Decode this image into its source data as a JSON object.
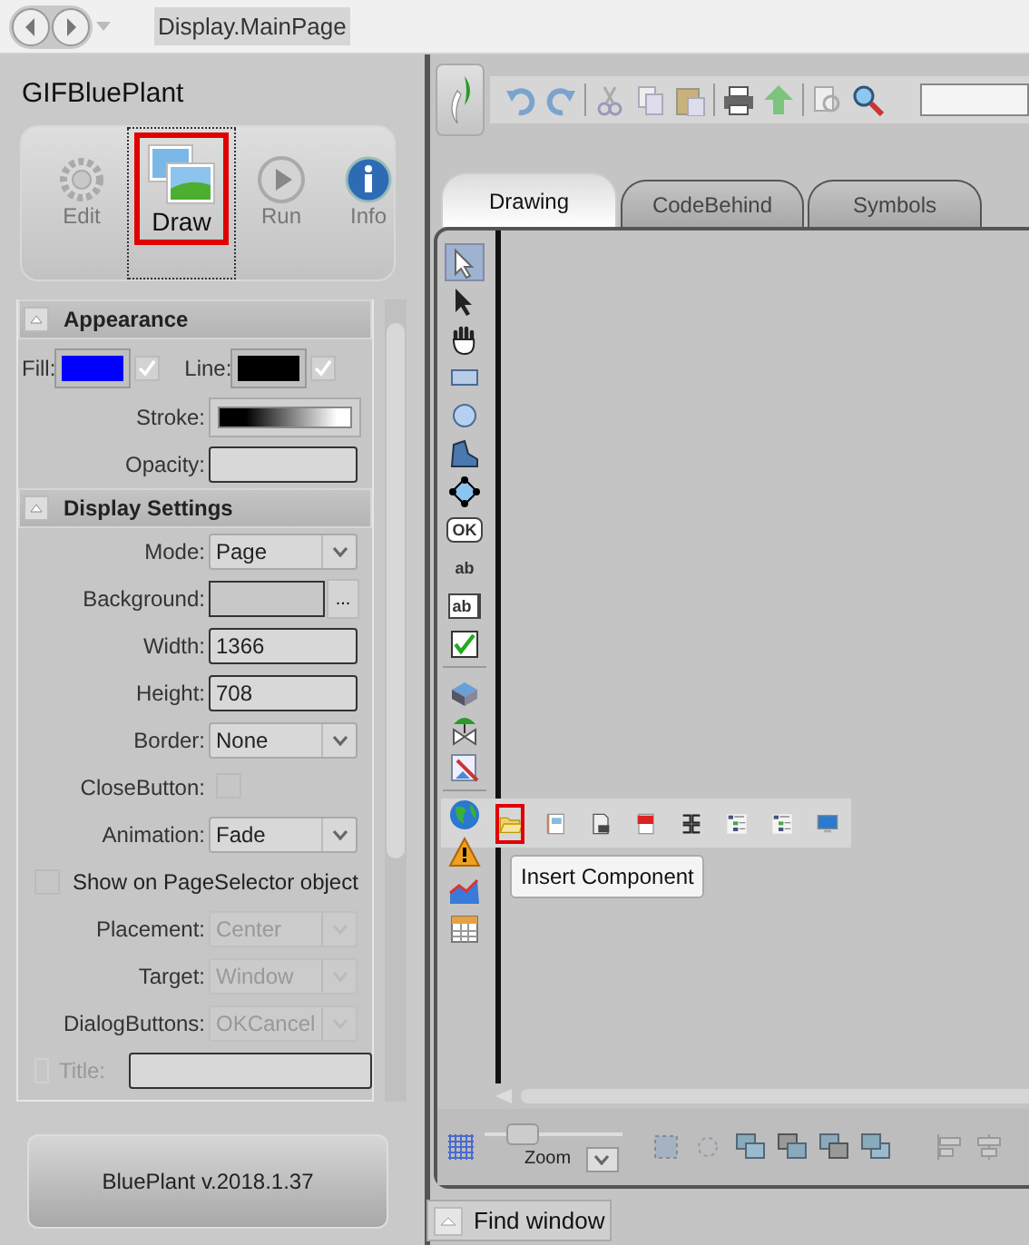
{
  "title_bar": {
    "title": "Display.MainPage"
  },
  "project": {
    "name": "GIFBluePlant"
  },
  "ribbon": [
    {
      "label": "Edit",
      "kind": "gear",
      "selected": false,
      "highlighted": false
    },
    {
      "label": "Draw",
      "kind": "pictures",
      "selected": true,
      "highlighted": true
    },
    {
      "label": "Run",
      "kind": "play",
      "selected": false,
      "highlighted": false
    },
    {
      "label": "Info",
      "kind": "info",
      "selected": false,
      "highlighted": false
    }
  ],
  "sections": [
    {
      "title": "Appearance",
      "expanded": true,
      "rows": [
        {
          "kind": "colors",
          "items": [
            {
              "label": "Fill:",
              "color": "#0000ff",
              "checked": true
            },
            {
              "label": "Line:",
              "color": "#000000",
              "checked": true
            }
          ]
        },
        {
          "kind": "gradient",
          "label": "Stroke:"
        },
        {
          "kind": "text",
          "label": "Opacity:"
        }
      ]
    },
    {
      "title": "Display Settings",
      "expanded": true,
      "rows": [
        {
          "kind": "dropdown",
          "label": "Mode:",
          "value": "Page",
          "disabled": false
        },
        {
          "kind": "browse",
          "label": "Background:",
          "button": "..."
        },
        {
          "kind": "text",
          "label": "Width:",
          "value": "1366"
        },
        {
          "kind": "text",
          "label": "Height:",
          "value": "708"
        },
        {
          "kind": "dropdown",
          "label": "Border:",
          "value": "None",
          "disabled": false
        },
        {
          "kind": "checkbox",
          "label": "CloseButton:",
          "checked": false
        },
        {
          "kind": "dropdown",
          "label": "Animation:",
          "value": "Fade",
          "disabled": false
        },
        {
          "kind": "check_row",
          "label": "Show on PageSelector object",
          "checked": false
        },
        {
          "kind": "dropdown",
          "label": "Placement:",
          "value": "Center",
          "disabled": true
        },
        {
          "kind": "dropdown",
          "label": "Target:",
          "value": "Window",
          "disabled": true
        },
        {
          "kind": "dropdown",
          "label": "DialogButtons:",
          "value": "OKCancel",
          "disabled": true
        },
        {
          "kind": "check_field",
          "label": "Title:",
          "checked": false,
          "disabled": true
        }
      ]
    }
  ],
  "version_button": {
    "label": "BluePlant v.2018.1.37"
  },
  "tabs": [
    {
      "label": "Drawing",
      "selected": true
    },
    {
      "label": "CodeBehind",
      "selected": false
    },
    {
      "label": "Symbols",
      "selected": false
    }
  ],
  "toolbox": [
    {
      "kind": "select",
      "selected": true
    },
    {
      "kind": "pointer",
      "selected": false
    },
    {
      "kind": "hand",
      "selected": false
    },
    {
      "kind": "rectangle",
      "selected": false
    },
    {
      "kind": "ellipse",
      "selected": false
    },
    {
      "kind": "polygon",
      "selected": false
    },
    {
      "kind": "node",
      "selected": false
    },
    {
      "kind": "button",
      "glyph": "OK",
      "selected": false
    },
    {
      "kind": "label",
      "glyph": "ab",
      "selected": false
    },
    {
      "kind": "textbox",
      "glyph": "ab",
      "selected": false
    },
    {
      "kind": "checkbox",
      "selected": false
    },
    {
      "kind": "symbol",
      "selected": false
    },
    {
      "kind": "valve",
      "selected": false
    },
    {
      "kind": "image",
      "selected": false
    },
    {
      "kind": "globe",
      "selected": false
    },
    {
      "kind": "warning",
      "selected": false
    },
    {
      "kind": "chart",
      "selected": false
    },
    {
      "kind": "table",
      "selected": false
    }
  ],
  "flyout": [
    {
      "kind": "folder",
      "highlighted": true
    },
    {
      "kind": "form",
      "highlighted": false
    },
    {
      "kind": "document",
      "highlighted": false
    },
    {
      "kind": "report",
      "highlighted": false
    },
    {
      "kind": "brackets",
      "highlighted": false
    },
    {
      "kind": "tree",
      "highlighted": false
    },
    {
      "kind": "tree",
      "highlighted": false
    },
    {
      "kind": "monitor",
      "highlighted": false
    }
  ],
  "tooltip": {
    "text": "Insert Component"
  },
  "zoom": {
    "label": "Zoom",
    "level": 0.2
  },
  "find_window": {
    "label": "Find window"
  }
}
